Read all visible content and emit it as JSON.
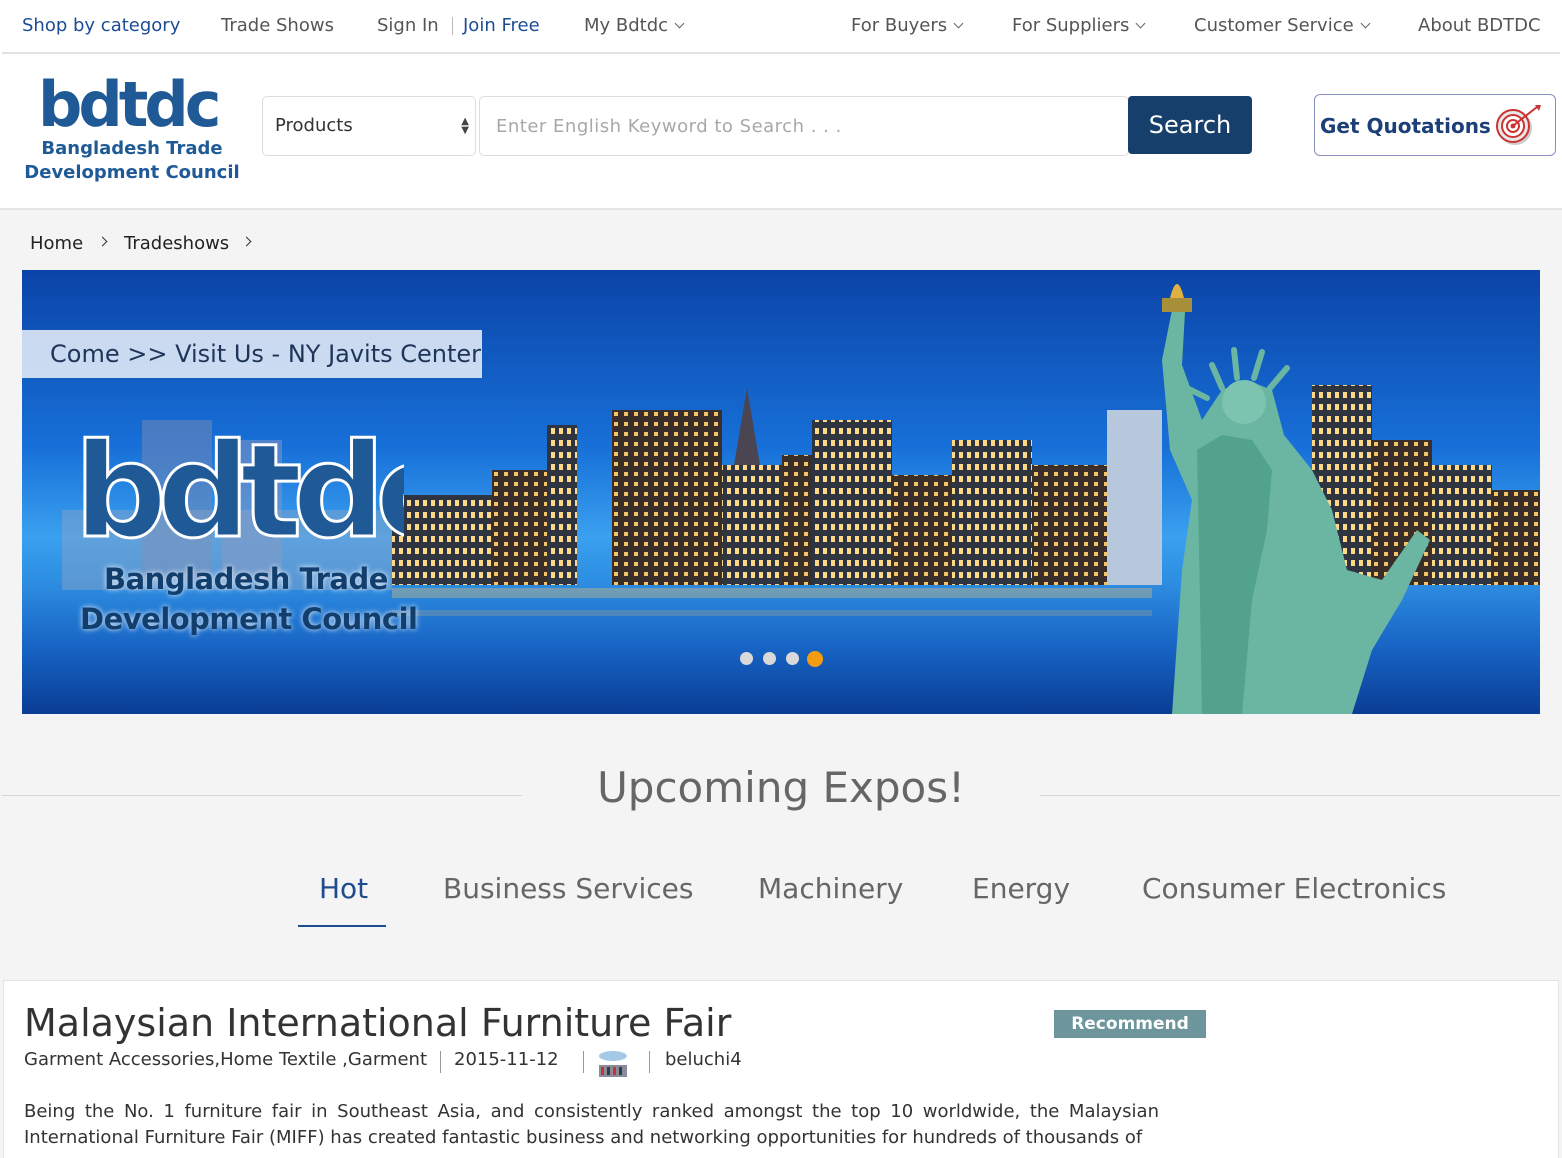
{
  "topnav": {
    "shop_by_category": "Shop by category",
    "trade_shows": "Trade Shows",
    "sign_in": "Sign In",
    "join_free": "Join Free",
    "my_bdtdc": "My Bdtdc",
    "for_buyers": "For Buyers",
    "for_suppliers": "For Suppliers",
    "customer_service": "Customer Service",
    "about": "About BDTDC"
  },
  "header": {
    "logo_text": "bdtdc",
    "logo_line1": "Bangladesh Trade",
    "logo_line2": "Development Council",
    "product_select": "Products",
    "search_placeholder": "Enter English Keyword to Search . . .",
    "search_button": "Search",
    "quote_button": "Get Quotations"
  },
  "breadcrumb": {
    "home": "Home",
    "tradeshows": "Tradeshows"
  },
  "banner": {
    "tagline": "Come >> Visit Us - NY Javits Center",
    "logo_line1": "Bangladesh Trade",
    "logo_line2": "Development Council",
    "slide_count": 4,
    "active_slide": 4
  },
  "section": {
    "title": "Upcoming Expos!"
  },
  "tabs": [
    "Hot",
    "Business Services",
    "Machinery",
    "Energy",
    "Consumer Electronics"
  ],
  "expo": {
    "title": "Malaysian International Furniture Fair",
    "badge": "Recommend",
    "categories": "Garment Accessories,Home Textile ,Garment",
    "date": "2015-11-12",
    "user": "beluchi4",
    "description": "Being the No. 1 furniture fair in Southeast Asia, and consistently ranked amongst the top 10 worldwide, the Malaysian International Furniture Fair (MIFF) has created fantastic business and networking opportunities for hundreds of thousands of"
  },
  "colors": {
    "brand_blue": "#173f6b",
    "link_blue": "#1c4c96",
    "active_tab": "#1f4c8c",
    "badge": "#6d959c",
    "active_dot": "#f39c12"
  }
}
